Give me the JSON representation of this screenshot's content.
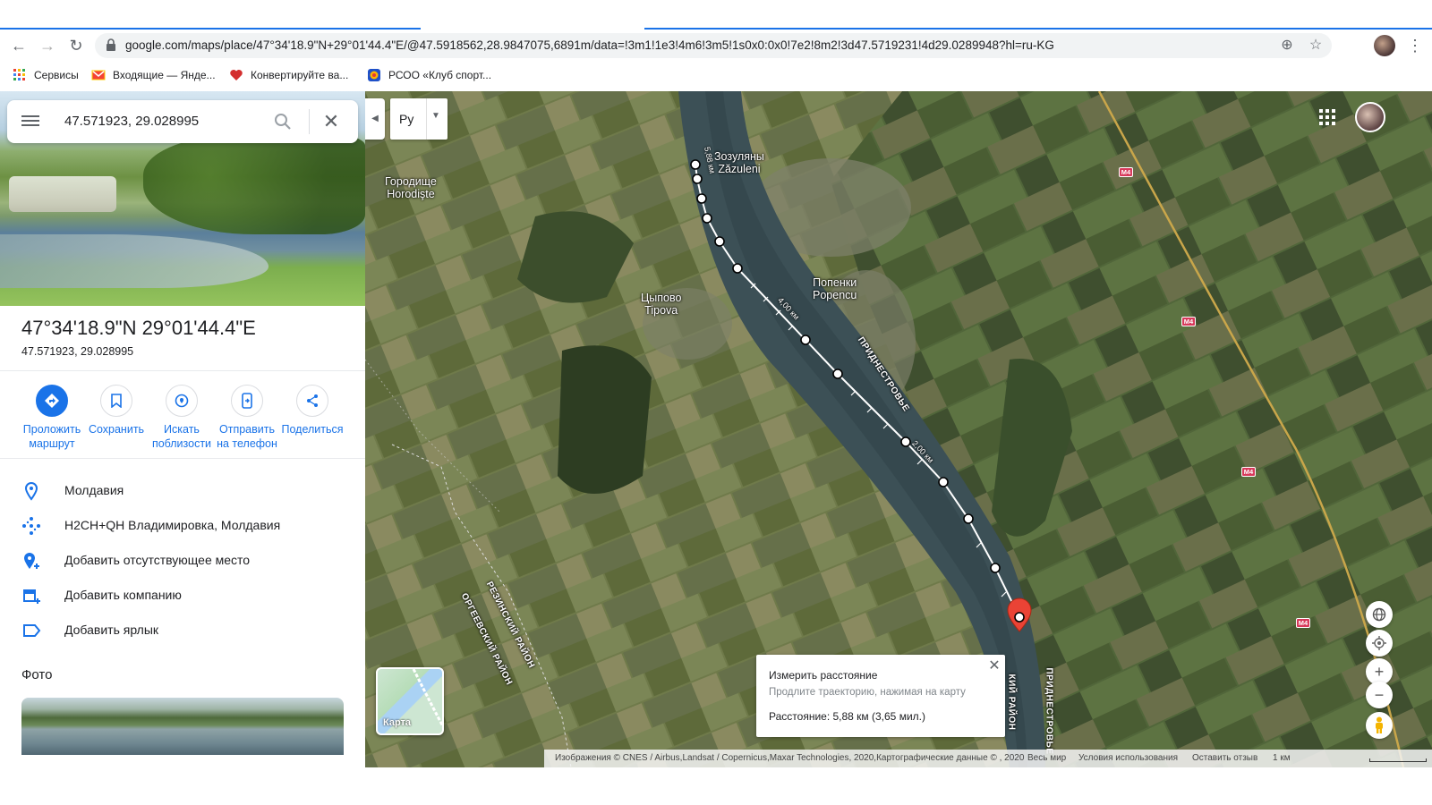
{
  "browser": {
    "url": "google.com/maps/place/47°34'18.9\"N+29°01'44.4\"E/@47.5918562,28.9847075,6891m/data=!3m1!1e3!4m6!3m5!1s0x0:0x0!7e2!8m2!3d47.5719231!4d29.0289948?hl=ru-KG",
    "bookmarks": [
      {
        "label": "Сервисы",
        "icon": "apps-icon"
      },
      {
        "label": "Входящие — Янде...",
        "icon": "mail-icon"
      },
      {
        "label": "Конвертируйте ва...",
        "icon": "heart-icon"
      },
      {
        "label": "РСОО «Клуб спорт...",
        "icon": "club-icon"
      }
    ]
  },
  "search": {
    "query": "47.571923, 29.028995"
  },
  "place": {
    "title": "47°34'18.9\"N 29°01'44.4\"E",
    "subtitle": "47.571923, 29.028995"
  },
  "actions": [
    {
      "line1": "Проложить",
      "line2": "маршрут"
    },
    {
      "line1": "Сохранить",
      "line2": ""
    },
    {
      "line1": "Искать",
      "line2": "поблизости"
    },
    {
      "line1": "Отправить",
      "line2": "на телефон"
    },
    {
      "line1": "Поделиться",
      "line2": ""
    }
  ],
  "info_rows": [
    {
      "text": "Молдавия",
      "icon": "location-pin-icon"
    },
    {
      "text": "H2CH+QH Владимировка, Молдавия",
      "icon": "plus-code-icon"
    },
    {
      "text": "Добавить отсутствующее место",
      "icon": "add-place-icon"
    },
    {
      "text": "Добавить компанию",
      "icon": "add-business-icon"
    },
    {
      "text": "Добавить ярлык",
      "icon": "label-icon"
    }
  ],
  "photos_title": "Фото",
  "map": {
    "lang_button": "Ру",
    "layer_toggle": "Карта",
    "places": [
      {
        "line1": "Городище",
        "line2": "Horodişte"
      },
      {
        "line1": "Зозуляны",
        "line2": "Zăzuleni"
      },
      {
        "line1": "Цыпово",
        "line2": "Tipova"
      },
      {
        "line1": "Попенки",
        "line2": "Popencu"
      }
    ],
    "region_labels": [
      "ПРИДНЕСТРОВЬЕ",
      "РЕЗИНСКИЙ РАЙОН",
      "ОРГЕЕВСКИЙ РАЙОН",
      "ПРИДНЕСТРОВЬЕ",
      "КИЙ РАЙОН"
    ],
    "distance_marks": [
      "5,88 км",
      "4,00 км",
      "2,00 км"
    ],
    "road": "M4",
    "measure": {
      "title": "Измерить расстояние",
      "hint": "Продлите траекторию, нажимая на карту",
      "distance": "Расстояние: 5,88 км (3,65 мил.)"
    },
    "attribution": {
      "imagery": "Изображения © CNES / Airbus,Landsat / Copernicus,Maxar Technologies, 2020,Картографические данные © , 2020",
      "world": "Весь мир",
      "terms": "Условия использования",
      "feedback": "Оставить отзыв",
      "scale": "1 км"
    }
  },
  "colors": {
    "accent": "#1a73e8",
    "marker": "#ea4335",
    "road": "#d7395b"
  }
}
